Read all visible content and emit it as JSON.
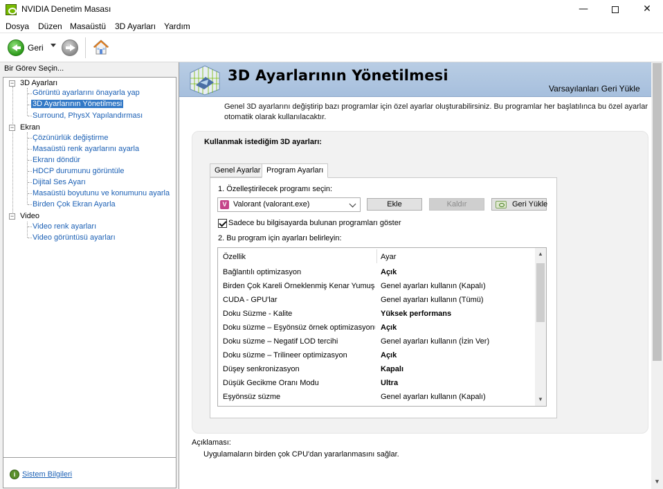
{
  "window": {
    "title": "NVIDIA Denetim Masası",
    "minimize": "—",
    "maximize": "",
    "close": "✕"
  },
  "menu": [
    "Dosya",
    "Düzen",
    "Masaüstü",
    "3D Ayarları",
    "Yardım"
  ],
  "toolbar": {
    "back_label": "Geri"
  },
  "left": {
    "header": "Bir Görev Seçin...",
    "categories": [
      {
        "label": "3D Ayarları",
        "items": [
          "Görüntü ayarlarını önayarla yap",
          "3D Ayarlarının Yönetilmesi",
          "Surround, PhysX Yapılandırması"
        ]
      },
      {
        "label": "Ekran",
        "items": [
          "Çözünürlük değiştirme",
          "Masaüstü renk ayarlarını ayarla",
          "Ekranı döndür",
          "HDCP durumunu görüntüle",
          "Dijital Ses Ayarı",
          "Masaüstü boyutunu ve konumunu ayarla",
          "Birden Çok Ekran Ayarla"
        ]
      },
      {
        "label": "Video",
        "items": [
          "Video renk ayarları",
          "Video görüntüsü ayarları"
        ]
      }
    ],
    "selected": "3D Ayarlarının Yönetilmesi",
    "system_info": "Sistem Bilgileri"
  },
  "main": {
    "title": "3D Ayarlarının Yönetilmesi",
    "restore_defaults": "Varsayılanları Geri Yükle",
    "description": "Genel 3D ayarlarını değiştirip bazı programlar için özel ayarlar oluşturabilirsiniz. Bu programlar her başlatılınca bu özel ayarlar otomatik olarak kullanılacaktır.",
    "group_title": "Kullanmak istediğim 3D ayarları:",
    "tabs": [
      "Genel Ayarlar",
      "Program Ayarları"
    ],
    "active_tab": "Program Ayarları",
    "step1": "1. Özelleştirilecek programı seçin:",
    "program": "Valorant (valorant.exe)",
    "buttons": {
      "add": "Ekle",
      "remove": "Kaldır",
      "restore": "Geri Yükle"
    },
    "show_only_label": "Sadece bu bilgisayarda bulunan programları göster",
    "show_only_checked": true,
    "step2": "2. Bu program için ayarları belirleyin:",
    "table": {
      "headers": [
        "Özellik",
        "Ayar"
      ],
      "rows": [
        {
          "feature": "Bağlantılı optimizasyon",
          "value": "Açık",
          "bold": true
        },
        {
          "feature": "Birden Çok Kareli Örneklenmiş Kenar Yumuşatma",
          "value": "Genel ayarları kullanın (Kapalı)",
          "bold": false
        },
        {
          "feature": "CUDA - GPU'lar",
          "value": "Genel ayarları kullanın (Tümü)",
          "bold": false
        },
        {
          "feature": "Doku Süzme - Kalite",
          "value": "Yüksek performans",
          "bold": true
        },
        {
          "feature": "Doku süzme – Eşyönsüz örnek optimizasyonu",
          "value": "Açık",
          "bold": true
        },
        {
          "feature": "Doku süzme – Negatif LOD tercihi",
          "value": "Genel ayarları kullanın (İzin Ver)",
          "bold": false
        },
        {
          "feature": "Doku süzme – Trilineer optimizasyon",
          "value": "Açık",
          "bold": true
        },
        {
          "feature": "Düşey senkronizasyon",
          "value": "Kapalı",
          "bold": true
        },
        {
          "feature": "Düşük Gecikme Oranı Modu",
          "value": "Ultra",
          "bold": true
        },
        {
          "feature": "Eşyönsüz süzme",
          "value": "Genel ayarları kullanın (Kapalı)",
          "bold": false
        }
      ]
    },
    "explanation_label": "Açıklaması:",
    "explanation_text": "Uygulamaların birden çok CPU'dan yararlanmasını sağlar."
  },
  "colors": {
    "link": "#1a5fb4",
    "selection": "#3178c6",
    "banner": "#b9cde4",
    "nvidia_green": "#76b900"
  }
}
